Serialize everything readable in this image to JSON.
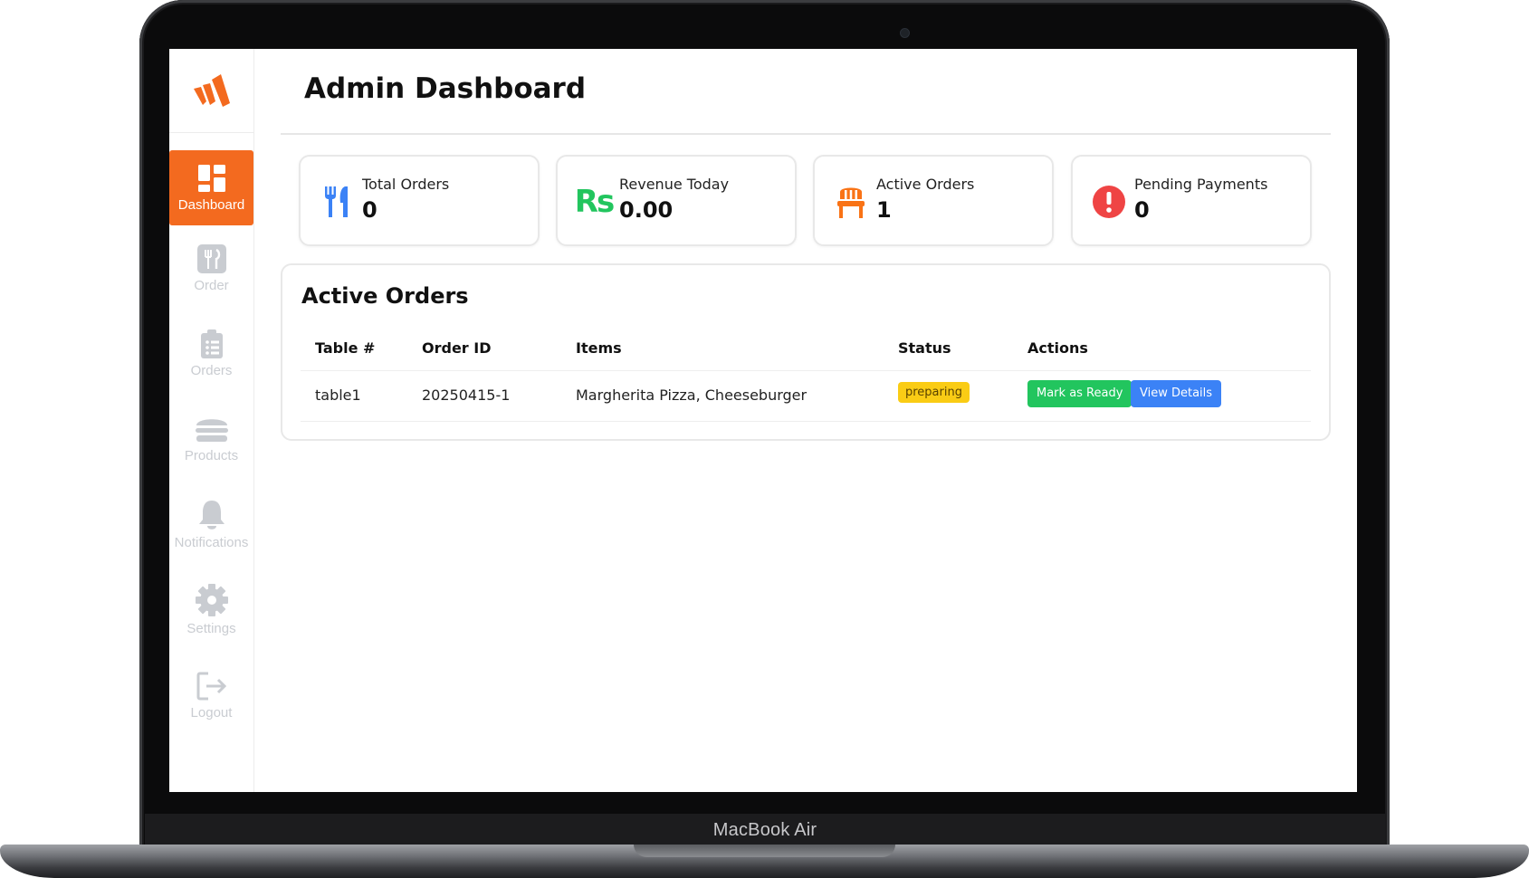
{
  "device": {
    "brand_label": "MacBook Air"
  },
  "app": {
    "accent_color": "#f36a1f"
  },
  "sidebar": {
    "items": [
      {
        "label": "Dashboard",
        "icon": "dashboard-grid-icon",
        "active": true
      },
      {
        "label": "Order",
        "icon": "utensils-icon"
      },
      {
        "label": "Orders",
        "icon": "clipboard-list-icon"
      },
      {
        "label": "Products",
        "icon": "burger-icon"
      },
      {
        "label": "Notifications",
        "icon": "bell-icon"
      },
      {
        "label": "Settings",
        "icon": "gear-icon"
      },
      {
        "label": "Logout",
        "icon": "logout-icon"
      }
    ]
  },
  "header": {
    "title": "Admin Dashboard"
  },
  "stats": [
    {
      "label": "Total Orders",
      "value": "0",
      "icon": "fork-knife-icon",
      "color": "#3b82f6"
    },
    {
      "label": "Revenue Today",
      "value": "0.00",
      "icon": "rupee-icon",
      "icon_text": "Rs",
      "color": "#22c55e"
    },
    {
      "label": "Active Orders",
      "value": "1",
      "icon": "chair-icon",
      "color": "#f97316"
    },
    {
      "label": "Pending Payments",
      "value": "0",
      "icon": "exclamation-circle-icon",
      "color": "#ef4444"
    }
  ],
  "active_orders": {
    "title": "Active Orders",
    "columns": [
      "Table #",
      "Order ID",
      "Items",
      "Status",
      "Actions"
    ],
    "rows": [
      {
        "table": "table1",
        "order_id": "20250415-1",
        "items": "Margherita Pizza, Cheeseburger",
        "status": "preparing",
        "actions": [
          "Mark as Ready",
          "View Details"
        ]
      }
    ]
  }
}
